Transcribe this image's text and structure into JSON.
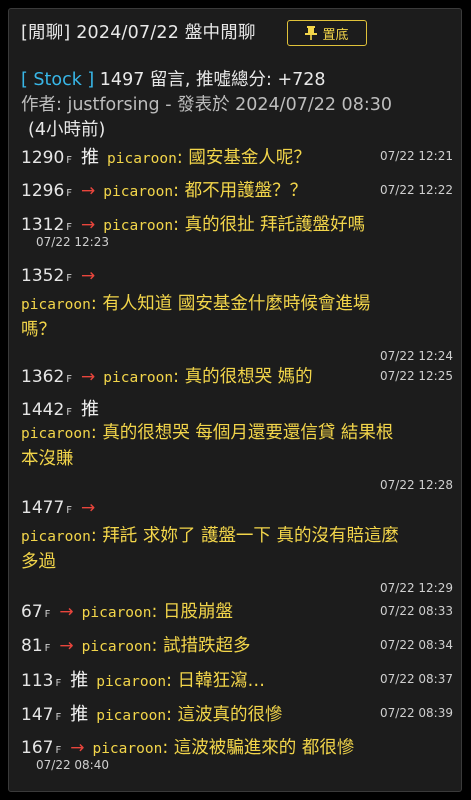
{
  "header": {
    "title": "[閒聊] 2024/07/22 盤中閒聊",
    "pin_label": "置底",
    "board_tag": "[ Stock ]",
    "stats": "1497 留言, 推噓總分: +728",
    "author_line": "作者: justforsing - 發表於 2024/07/22 08:30",
    "relative_time": "(4小時前)"
  },
  "comments": [
    {
      "floor": "1290",
      "type": "推",
      "user": "picaroon",
      "text": "國安基金人呢？",
      "time": "07/22 12:21"
    },
    {
      "floor": "1296",
      "type": "→",
      "user": "picaroon",
      "text": "都不用護盤？？",
      "time": "07/22 12:22"
    },
    {
      "floor": "1312",
      "type": "→",
      "user": "picaroon",
      "text": "真的很扯 拜託護盤好嗎",
      "time": "07/22 12:23"
    },
    {
      "floor": "1352",
      "type": "→",
      "user": "picaroon",
      "text": "有人知道 國安基金什麼時候會進場",
      "text2": "嗎？",
      "time": "07/22 12:24"
    },
    {
      "floor": "1362",
      "type": "→",
      "user": "picaroon",
      "text": "真的很想哭 媽的",
      "time": "07/22 12:25"
    },
    {
      "floor": "1442",
      "type": "推",
      "user": "picaroon",
      "text": "真的很想哭 每個月還要還信貸 結果根",
      "text2": "本沒賺",
      "time": "07/22 12:28"
    },
    {
      "floor": "1477",
      "type": "→",
      "user": "picaroon",
      "text": "拜託 求妳了 護盤一下 真的沒有賠這麼",
      "text2": "多過",
      "time": "07/22 12:29"
    },
    {
      "floor": "67",
      "type": "→",
      "user": "picaroon",
      "text": "日股崩盤",
      "time": "07/22 08:33"
    },
    {
      "floor": "81",
      "type": "→",
      "user": "picaroon",
      "text": "試措跌超多",
      "time": "07/22 08:34"
    },
    {
      "floor": "113",
      "type": "推",
      "user": "picaroon",
      "text": "日韓狂瀉…",
      "time": "07/22 08:37"
    },
    {
      "floor": "147",
      "type": "推",
      "user": "picaroon",
      "text": "這波真的很慘",
      "time": "07/22 08:39"
    },
    {
      "floor": "167",
      "type": "→",
      "user": "picaroon",
      "text": "這波被騙進來的 都很慘",
      "time": "07/22 08:40"
    }
  ],
  "floor_suffix": "F"
}
